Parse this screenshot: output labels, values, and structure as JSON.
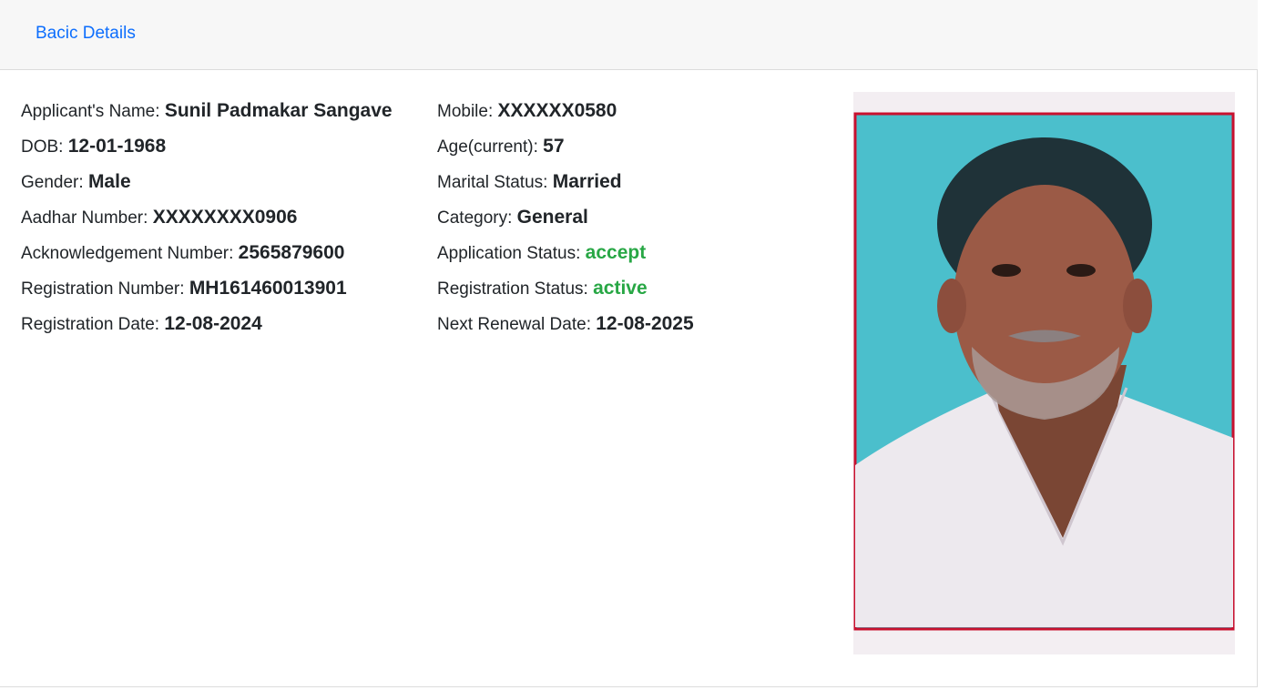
{
  "header": {
    "tab_label": "Bacic Details"
  },
  "left_fields": [
    {
      "label": "Applicant's Name:",
      "value": "Sunil Padmakar Sangave"
    },
    {
      "label": "DOB:",
      "value": "12-01-1968"
    },
    {
      "label": "Gender:",
      "value": "Male"
    },
    {
      "label": "Aadhar Number:",
      "value": "XXXXXXXX0906"
    },
    {
      "label": "Acknowledgement Number:",
      "value": "2565879600"
    },
    {
      "label": "Registration Number:",
      "value": "MH161460013901"
    },
    {
      "label": "Registration Date:",
      "value": "12-08-2024"
    }
  ],
  "right_fields": [
    {
      "label": "Mobile:",
      "value": "XXXXXX0580"
    },
    {
      "label": "Age(current):",
      "value": "57"
    },
    {
      "label": "Marital Status:",
      "value": "Married"
    },
    {
      "label": "Category:",
      "value": "General"
    },
    {
      "label": "Application Status:",
      "value": "accept"
    },
    {
      "label": "Registration Status:",
      "value": "active"
    },
    {
      "label": "Next Renewal Date:",
      "value": "12-08-2025"
    }
  ],
  "colors": {
    "link": "#0d6efd",
    "status_green": "#28a745",
    "photo_background": "#4bbfcc",
    "photo_border": "#c8102e"
  }
}
